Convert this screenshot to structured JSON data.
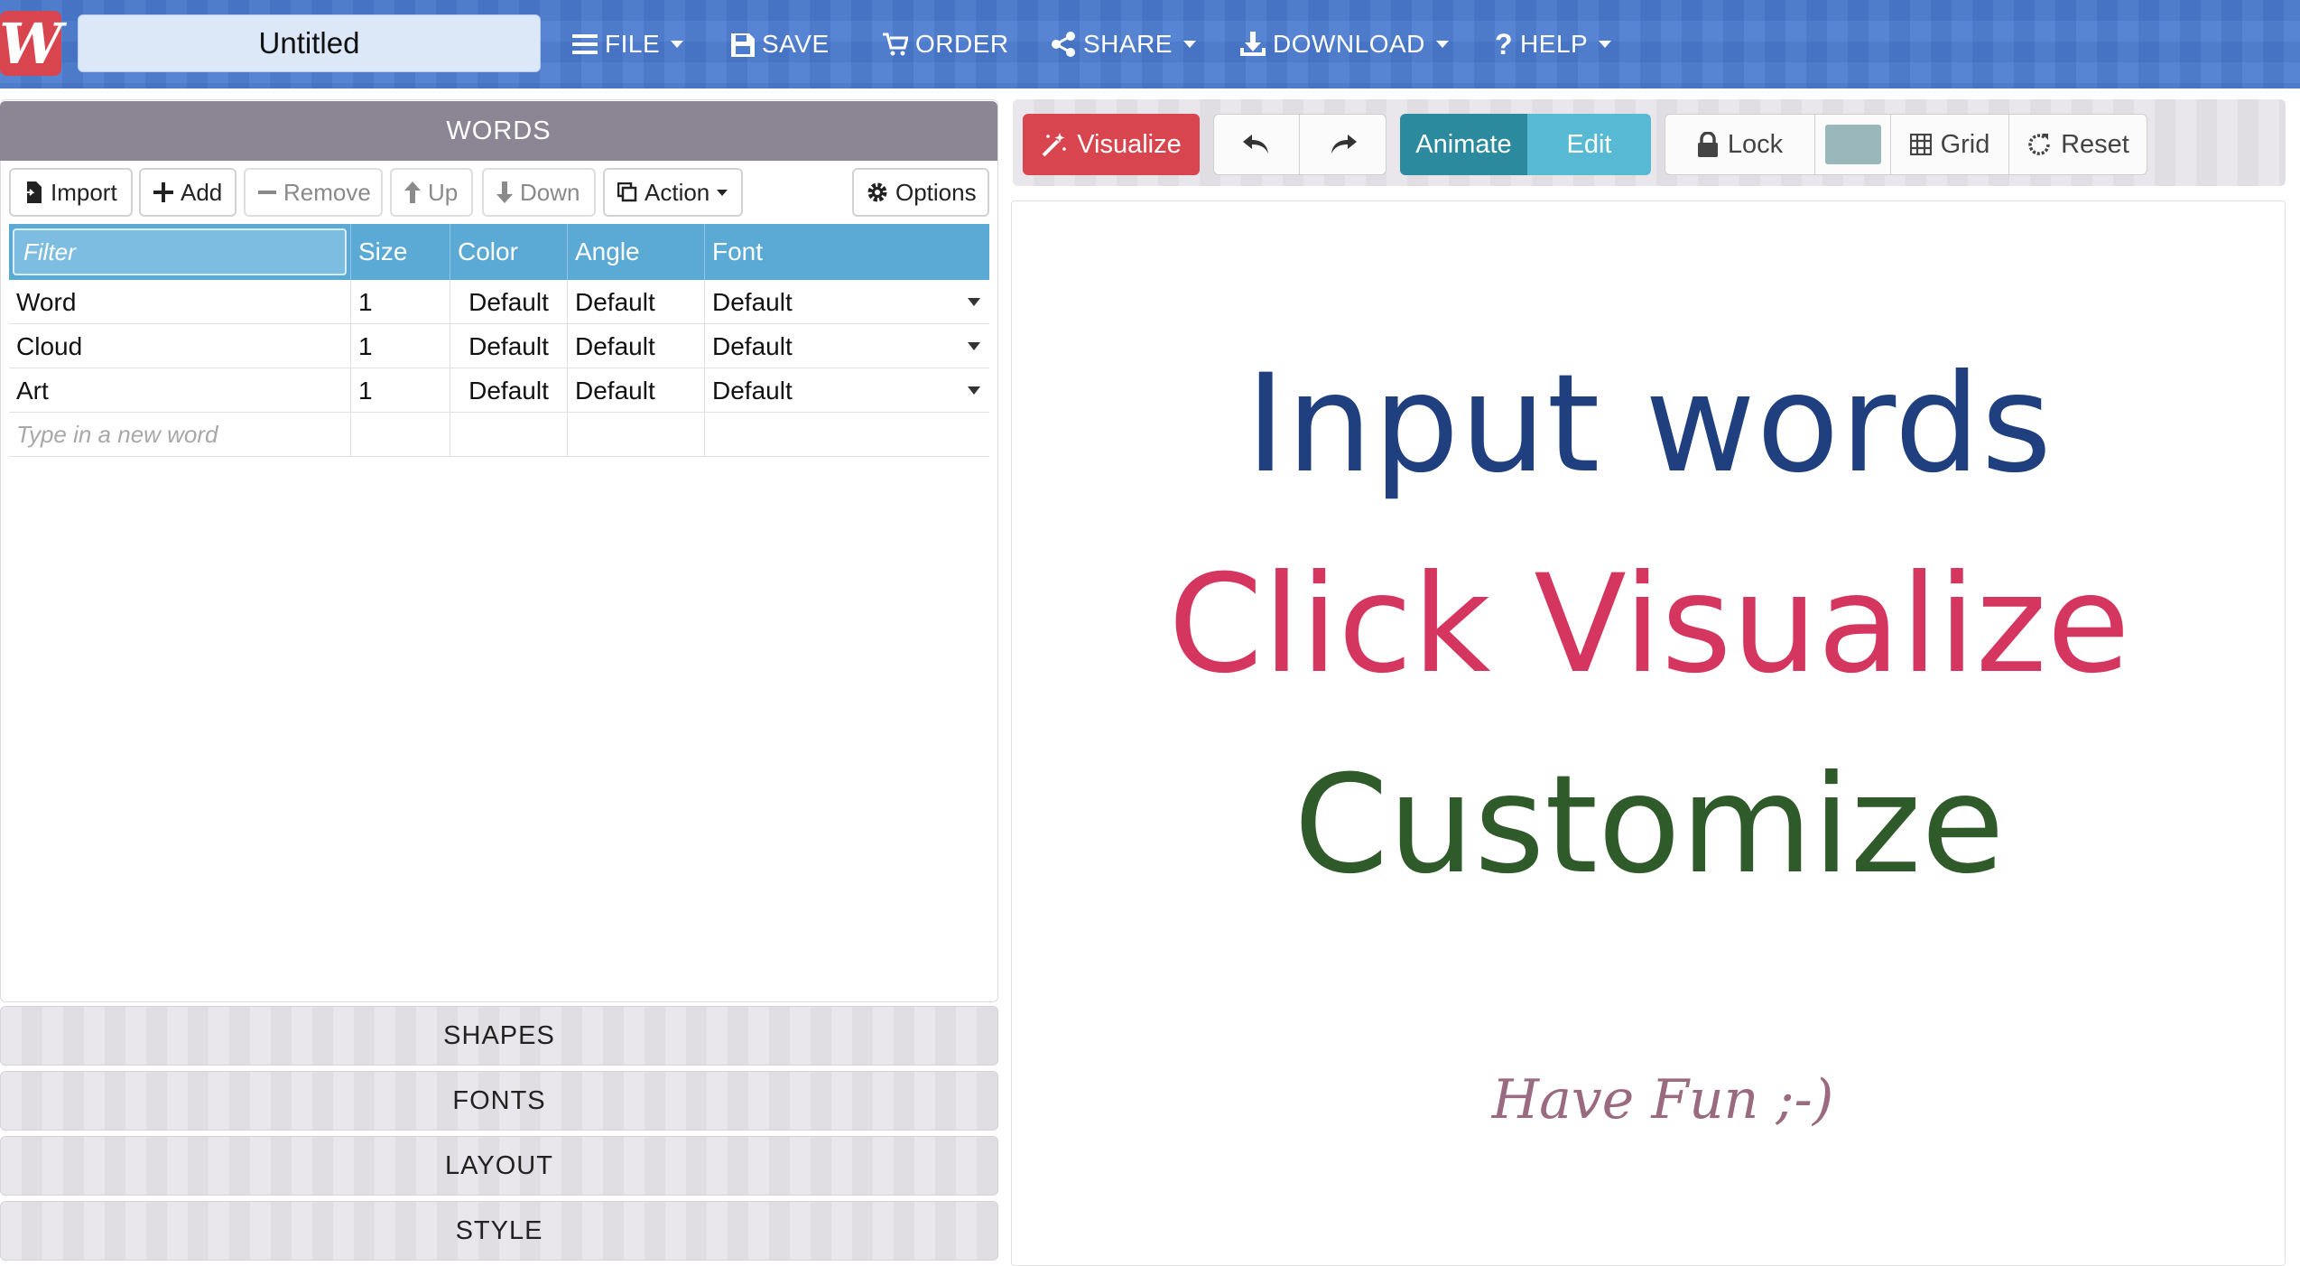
{
  "header": {
    "logo_letter": "W",
    "doc_title": "Untitled",
    "menu": {
      "file": "FILE",
      "save": "SAVE",
      "order": "ORDER",
      "share": "SHARE",
      "download": "DOWNLOAD",
      "help": "HELP"
    }
  },
  "words_panel": {
    "title": "WORDS",
    "toolbar": {
      "import": "Import",
      "add": "Add",
      "remove": "Remove",
      "up": "Up",
      "down": "Down",
      "action": "Action",
      "options": "Options"
    },
    "filter_placeholder": "Filter",
    "columns": {
      "size": "Size",
      "color": "Color",
      "angle": "Angle",
      "font": "Font"
    },
    "rows": [
      {
        "word": "Word",
        "size": "1",
        "color": "Default",
        "angle": "Default",
        "font": "Default"
      },
      {
        "word": "Cloud",
        "size": "1",
        "color": "Default",
        "angle": "Default",
        "font": "Default"
      },
      {
        "word": "Art",
        "size": "1",
        "color": "Default",
        "angle": "Default",
        "font": "Default"
      }
    ],
    "new_word_placeholder": "Type in a new word"
  },
  "sections": {
    "shapes": "SHAPES",
    "fonts": "FONTS",
    "layout": "LAYOUT",
    "style": "STYLE"
  },
  "canvas_toolbar": {
    "visualize": "Visualize",
    "animate": "Animate",
    "edit": "Edit",
    "lock": "Lock",
    "grid": "Grid",
    "reset": "Reset",
    "swatch_color": "#9ab8bc"
  },
  "canvas": {
    "line1": "Input words",
    "line2": "Click Visualize",
    "line3": "Customize",
    "line4": "Have Fun ;-)"
  },
  "colors": {
    "navbar": "#4a7bcf",
    "accent_red": "#d9454f",
    "grid_header": "#5aaad5",
    "line1": "#1f3f7f",
    "line2": "#d5365f",
    "line3": "#2f5a2a",
    "line4": "#9a6a80"
  }
}
